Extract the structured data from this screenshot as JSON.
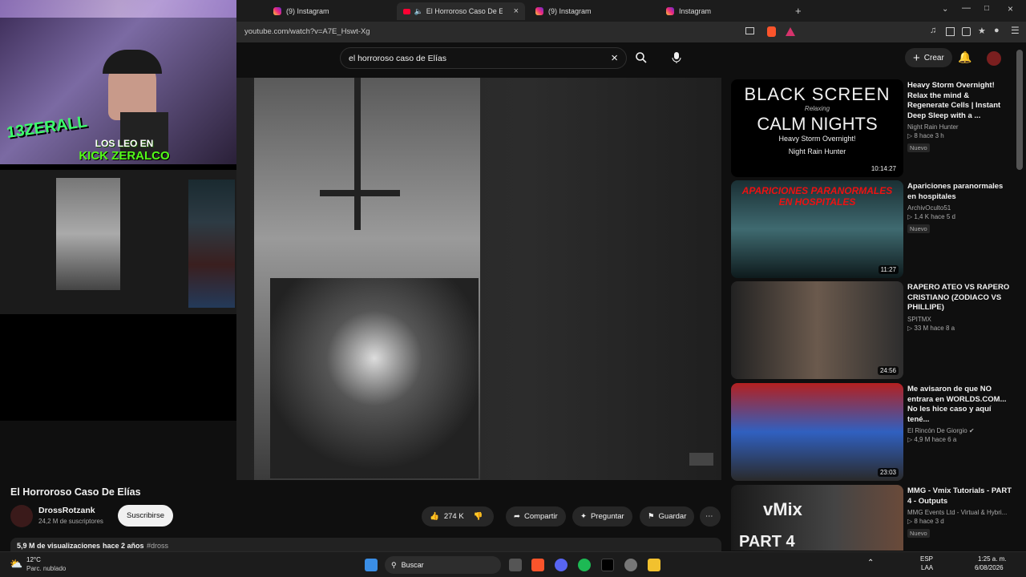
{
  "tabs": [
    {
      "label": "(9) Instagram"
    },
    {
      "label": "El Horroroso Caso De Elías - Y"
    },
    {
      "label": "(9) Instagram"
    },
    {
      "label": "Instagram"
    }
  ],
  "address": {
    "url": "youtube.com/watch?v=A7E_Hswt-Xg"
  },
  "search": {
    "value": "el horroroso caso de Elías"
  },
  "header": {
    "create_label": "Crear"
  },
  "video": {
    "title": "El Horroroso Caso De Elías",
    "channel": "DrossRotzank",
    "subs": "24,2 M de suscriptores",
    "subscribe_label": "Suscribirse",
    "likes": "274 K",
    "share_label": "Compartir",
    "ask_label": "Preguntar",
    "save_label": "Guardar",
    "views": "5,9 M de visualizaciones",
    "age": "hace 2 años",
    "hashtag": "#dross"
  },
  "recs": [
    {
      "title": "Heavy Storm Overnight! Relax the mind & Regenerate Cells | Instant Deep Sleep with a ...",
      "channel": "Night Rain Hunter",
      "stats": "8   hace 3 h",
      "badge": "Nuevo",
      "duration": "10:14:27",
      "thumb_lines": [
        "BLACK SCREEN",
        "Relaxing",
        "CALM NIGHTS",
        "Heavy Storm Overnight!",
        "Night Rain Hunter"
      ]
    },
    {
      "title": "Apariciones paranormales en hospitales",
      "channel": "ArchivOculto51",
      "stats": "1,4 K   hace 5 d",
      "badge": "Nuevo",
      "duration": "11:27",
      "thumb_lines": [
        "APARICIONES PARANORMALES",
        "EN HOSPITALES"
      ]
    },
    {
      "title": "RAPERO ATEO VS RAPERO CRISTIANO (ZODIACO VS PHILLIPE)",
      "channel": "SPITMX",
      "stats": "33 M   hace 8 a",
      "badge": "",
      "duration": "24:56",
      "thumb_lines": []
    },
    {
      "title": "Me avisaron de que NO entrara en WORLDS.COM... No les hice caso y aquí tené...",
      "channel": "El Rincón De Giorgio",
      "stats": "4,9 M   hace 6 a",
      "badge": "",
      "duration": "23:03",
      "thumb_lines": []
    },
    {
      "title": "MMG - Vmix Tutorials - PART 4 - Outputs",
      "channel": "MMG Events Ltd - Virtual & Hybri...",
      "stats": "8   hace 3 d",
      "badge": "Nuevo",
      "duration": "",
      "thumb_lines": [
        "vMix",
        "PART 4"
      ]
    }
  ],
  "overlay": {
    "banner_line1": "LOS LEO EN",
    "banner_line2": "KICK ZERALCO",
    "cam_tag": "13ZERALL"
  },
  "taskbar": {
    "weather_temp": "12°C",
    "weather_desc": "Parc. nublado",
    "search_label": "Buscar",
    "lang": "ESP",
    "lang2": "LAA",
    "time": "1:25 a. m.",
    "date": "6/08/2026"
  }
}
